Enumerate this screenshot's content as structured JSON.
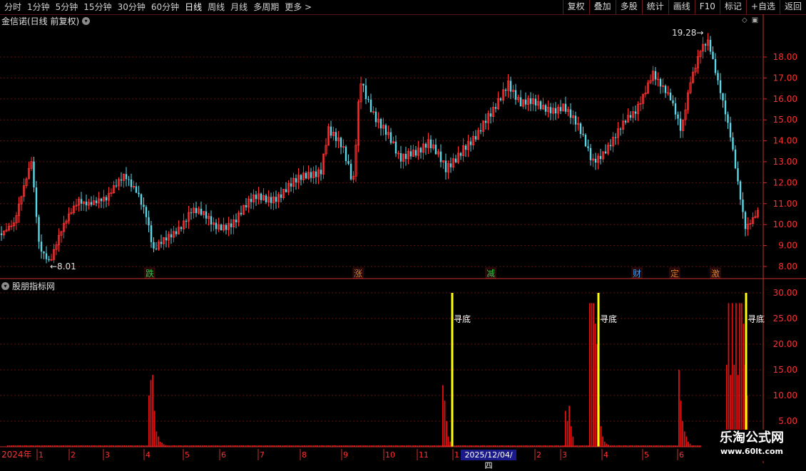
{
  "toolbar": {
    "periods": [
      "分时",
      "1分钟",
      "5分钟",
      "15分钟",
      "30分钟",
      "60分钟",
      "日线",
      "周线",
      "月线",
      "多周期",
      "更多 >"
    ],
    "active_index": 6,
    "right_buttons": [
      "复权",
      "叠加",
      "多股",
      "统计",
      "画线",
      "F10",
      "标记",
      "+自选",
      "返回"
    ]
  },
  "stock": {
    "title": "金信诺(日线 前复权)"
  },
  "indicator": {
    "title": "股朋指标网"
  },
  "price_axis": {
    "ticks": [
      "18.00",
      "17.00",
      "16.00",
      "15.00",
      "14.00",
      "13.00",
      "12.00",
      "11.00",
      "10.00",
      "9.00",
      "8.00"
    ]
  },
  "indicator_axis": {
    "ticks": [
      "30.00",
      "25.00",
      "20.00",
      "15.00",
      "10.00",
      "5.00"
    ]
  },
  "annotations": {
    "high_label": "19.28",
    "low_label": "8.01"
  },
  "event_tags": [
    {
      "text": "跌",
      "color": "#2ecc40"
    },
    {
      "text": "涨",
      "color": "#e67e22"
    },
    {
      "text": "减",
      "color": "#2ecc40"
    },
    {
      "text": "财",
      "color": "#3aa0ff"
    },
    {
      "text": "定",
      "color": "#e67e22"
    },
    {
      "text": "激",
      "color": "#e67e22"
    }
  ],
  "signals": [
    "寻底",
    "寻底",
    "寻底"
  ],
  "date_axis": {
    "year_label": "2024年",
    "months": [
      "1",
      "2",
      "3",
      "4",
      "5",
      "6",
      "7",
      "8",
      "9",
      "10",
      "11",
      "1",
      "2",
      "3",
      "4",
      "5",
      "6"
    ],
    "cursor_date": "2025/12/04/四"
  },
  "watermark": {
    "title": "乐淘公式网",
    "url": "www.60lt.com"
  },
  "colors": {
    "up": "#ff3030",
    "down": "#5ad8e8",
    "signal": "#ffff00",
    "grid": "#6a0f0f",
    "axis": "#c83232",
    "indicator_bar": "#e01010"
  }
}
